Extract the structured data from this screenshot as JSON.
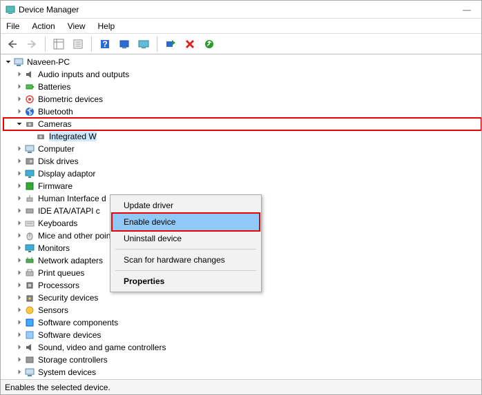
{
  "window": {
    "title": "Device Manager"
  },
  "menu": {
    "file": "File",
    "action": "Action",
    "view": "View",
    "help": "Help"
  },
  "root": "Naveen-PC",
  "categories": [
    "Audio inputs and outputs",
    "Batteries",
    "Biometric devices",
    "Bluetooth",
    "Cameras",
    "Computer",
    "Disk drives",
    "Display adaptor",
    "Firmware",
    "Human Interface d",
    "IDE ATA/ATAPI c",
    "Keyboards",
    "Mice and other pointing devices",
    "Monitors",
    "Network adapters",
    "Print queues",
    "Processors",
    "Security devices",
    "Sensors",
    "Software components",
    "Software devices",
    "Sound, video and game controllers",
    "Storage controllers",
    "System devices"
  ],
  "camera_child": "Integrated W",
  "context": {
    "update": "Update driver",
    "enable": "Enable device",
    "uninstall": "Uninstall device",
    "scan": "Scan for hardware changes",
    "properties": "Properties"
  },
  "status": "Enables the selected device."
}
